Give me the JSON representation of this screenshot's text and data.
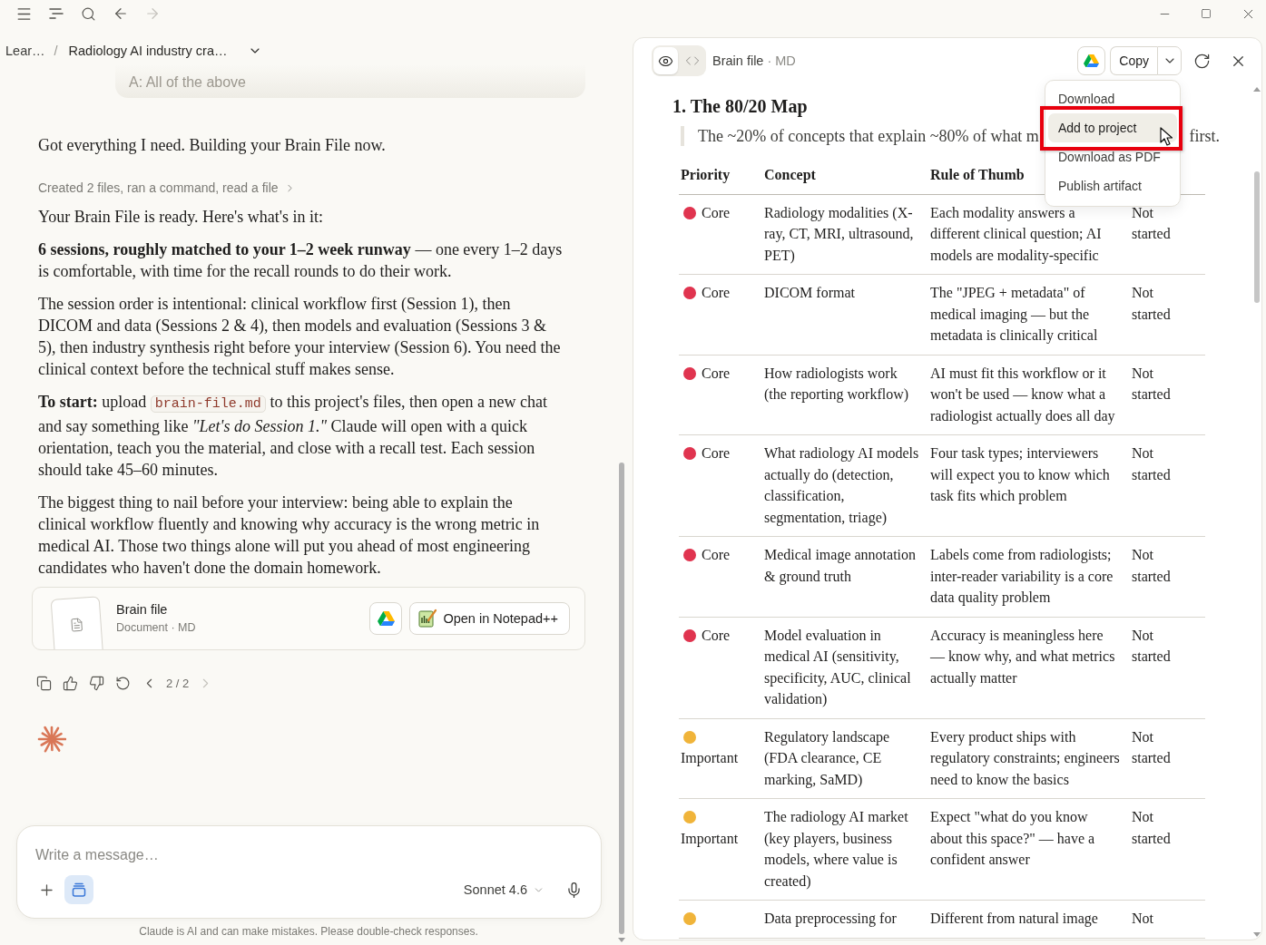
{
  "toolbar": [
    {
      "kind": "menu"
    },
    {
      "kind": "outline"
    },
    {
      "kind": "search"
    },
    {
      "kind": "back",
      "disabled": false
    },
    {
      "kind": "forward",
      "disabled": true
    }
  ],
  "window_controls": [
    {
      "kind": "minimize"
    },
    {
      "kind": "maximize"
    },
    {
      "kind": "close"
    }
  ],
  "breadcrumb": {
    "project": "Lear…",
    "separator": "/",
    "chat": "Radiology AI industry cra…"
  },
  "previous_message": "A: All of the above",
  "messages": [
    {
      "kind": "paragraph",
      "text": "Got everything I need. Building your Brain File now."
    },
    {
      "kind": "tool_summary",
      "text": "Created 2 files, ran a command, read a file"
    },
    {
      "kind": "paragraph",
      "text": "Your Brain File is ready. Here's what's in it:"
    },
    {
      "kind": "paragraph",
      "text": "**6 sessions, roughly matched to your 1–2 week runway** — one every 1–2 days is comfortable, with time for the recall rounds to do their work."
    },
    {
      "kind": "paragraph",
      "text": "The session order is intentional: clinical workflow first (Session 1), then DICOM and data (Sessions 2 & 4), then models and evaluation (Sessions 3 & 5), then industry synthesis right before your interview (Session 6). You need the clinical context before the technical stuff makes sense."
    },
    {
      "kind": "rich_paragraph",
      "parts": [
        {
          "kind": "text",
          "text": "**To start:** upload "
        },
        {
          "kind": "code",
          "text": "brain-file.md"
        },
        {
          "kind": "text",
          "text": " to this project's files, then open a new chat and say something like *\"Let's do Session 1.\"* Claude will open with a quick orientation, teach you the material, and close with a recall test. Each session should take 45–60 minutes."
        }
      ]
    },
    {
      "kind": "paragraph",
      "text": "The biggest thing to nail before your interview: being able to explain the clinical workflow fluently and knowing why accuracy is the wrong metric in medical AI. Those two things alone will put you ahead of most engineering candidates who haven't done the domain homework."
    }
  ],
  "file_card": {
    "title": "Brain file",
    "meta": "Document · MD",
    "open_button": "Open in Notepad++"
  },
  "message_actions": {
    "pager": "2 / 2",
    "prev_disabled": false,
    "next_disabled": true
  },
  "composer": {
    "placeholder": "Write a message…",
    "project_on": true,
    "model": "Sonnet 4.6"
  },
  "disclaimer": "Claude is AI and can make mistakes. Please double-check responses.",
  "panel": {
    "view_modes": [
      {
        "kind": "preview",
        "selected": true
      },
      {
        "kind": "code",
        "selected": false
      }
    ],
    "title": "Brain file",
    "meta": "· MD",
    "copy_button": "Copy",
    "menu": [
      {
        "label": "Download",
        "selected": false
      },
      {
        "label": "Add to project",
        "selected": true
      },
      {
        "label": "Download as PDF",
        "selected": false
      },
      {
        "label": "Publish artifact",
        "selected": false
      }
    ]
  },
  "document": {
    "heading": "1. The 80/20 Map",
    "quote_visible": [
      "The ~20% of concepts that explain ~80% of what m",
      "first."
    ],
    "table": {
      "columns": [
        "Priority",
        "Concept",
        "Rule of Thumb"
      ],
      "rows": [
        {
          "priority": "Core",
          "color": "#e0344f",
          "concept": "Radiology modalities (X-ray, CT, MRI, ultrasound, PET)",
          "rule": "Each modality answers a different clinical question; AI models are modality-specific",
          "column_4": "Not started"
        },
        {
          "priority": "Core",
          "color": "#e0344f",
          "concept": "DICOM format",
          "rule": "The \"JPEG + metadata\" of medical imaging — but the metadata is clinically critical",
          "column_4": "Not started"
        },
        {
          "priority": "Core",
          "color": "#e0344f",
          "concept": "How radiologists work (the reporting workflow)",
          "rule": "AI must fit this workflow or it won't be used — know what a radiologist actually does all day",
          "column_4": "Not started"
        },
        {
          "priority": "Core",
          "color": "#e0344f",
          "concept": "What radiology AI models actually do (detection, classification, segmentation, triage)",
          "rule": "Four task types; interviewers will expect you to know which task fits which problem",
          "column_4": "Not started"
        },
        {
          "priority": "Core",
          "color": "#e0344f",
          "concept": "Medical image annotation & ground truth",
          "rule": "Labels come from radiologists; inter-reader variability is a core data quality problem",
          "column_4": "Not started"
        },
        {
          "priority": "Core",
          "color": "#e0344f",
          "concept": "Model evaluation in medical AI (sensitivity, specificity, AUC, clinical validation)",
          "rule": "Accuracy is meaningless here — know why, and what metrics actually matter",
          "column_4": "Not started"
        },
        {
          "priority": "Important",
          "color": "#f0b43a",
          "concept": "Regulatory landscape (FDA clearance, CE marking, SaMD)",
          "rule": "Every product ships with regulatory constraints; engineers need to know the basics",
          "column_4": "Not started"
        },
        {
          "priority": "Important",
          "color": "#f0b43a",
          "concept": "The radiology AI market (key players, business models, where value is created)",
          "rule": "Expect \"what do you know about this space?\" — have a confident answer",
          "column_4": "Not started"
        },
        {
          "color": "#f0b43a",
          "concept": "Data preprocessing for",
          "rule": "Different from natural image",
          "column_4": "Not"
        }
      ]
    }
  }
}
